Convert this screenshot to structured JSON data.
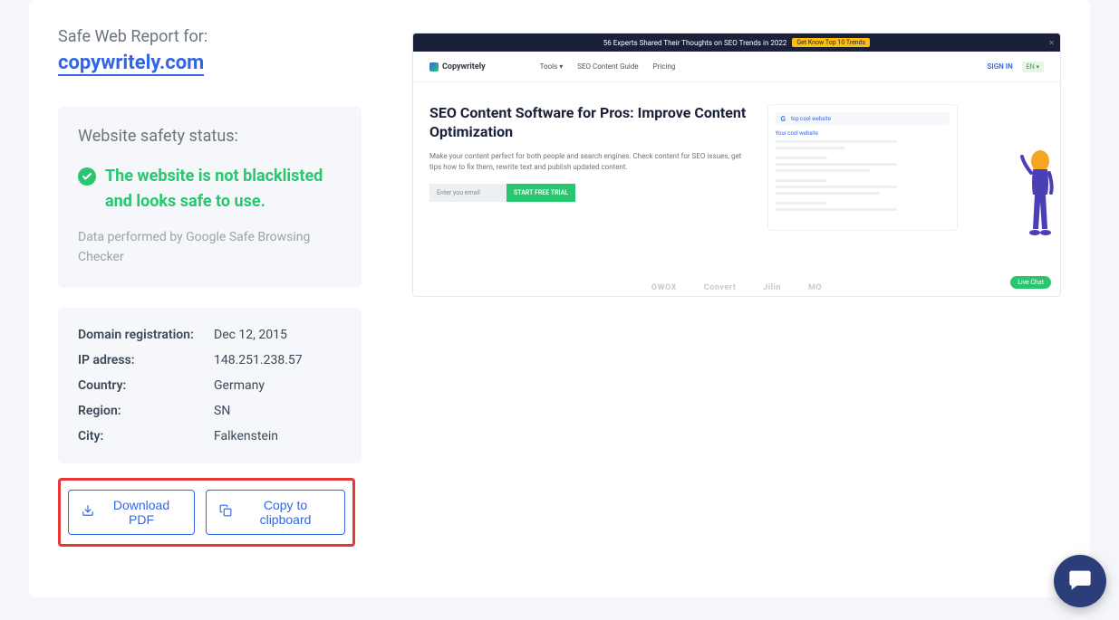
{
  "header": {
    "report_label": "Safe Web Report for:",
    "domain": "copywritely.com"
  },
  "safety_status": {
    "title": "Website safety status:",
    "message": "The website is not blacklisted and looks safe to use.",
    "source_note": "Data performed by Google Safe Browsing Checker"
  },
  "details": {
    "rows": [
      {
        "label": "Domain registration:",
        "value": "Dec 12, 2015"
      },
      {
        "label": "IP adress:",
        "value": "148.251.238.57"
      },
      {
        "label": "Country:",
        "value": "Germany"
      },
      {
        "label": "Region:",
        "value": "SN"
      },
      {
        "label": "City:",
        "value": "Falkenstein"
      }
    ]
  },
  "actions": {
    "download_pdf": "Download PDF",
    "copy_clipboard": "Copy to clipboard"
  },
  "preview": {
    "banner_text": "56 Experts Shared Their Thoughts on SEO Trends in 2022",
    "banner_button": "Get Know Top 10 Trends",
    "logo": "Copywritely",
    "nav_items": [
      "Tools",
      "SEO Content Guide",
      "Pricing"
    ],
    "signin": "SIGN IN",
    "lang": "EN",
    "hero_title": "SEO Content Software for Pros: Improve Content Optimization",
    "hero_desc": "Make your content perfect for both people and search engines. Check content for SEO issues, get tips how to fix them, rewrite text and publish updated content.",
    "email_placeholder": "Enter you email",
    "start_trial": "START FREE TRIAL",
    "search_placeholder": "top cool website",
    "result_title": "Your cool website",
    "livechat": "Live Chat",
    "footer_logos": [
      "OWOX",
      "Convert",
      "Jilin",
      "MO"
    ]
  }
}
